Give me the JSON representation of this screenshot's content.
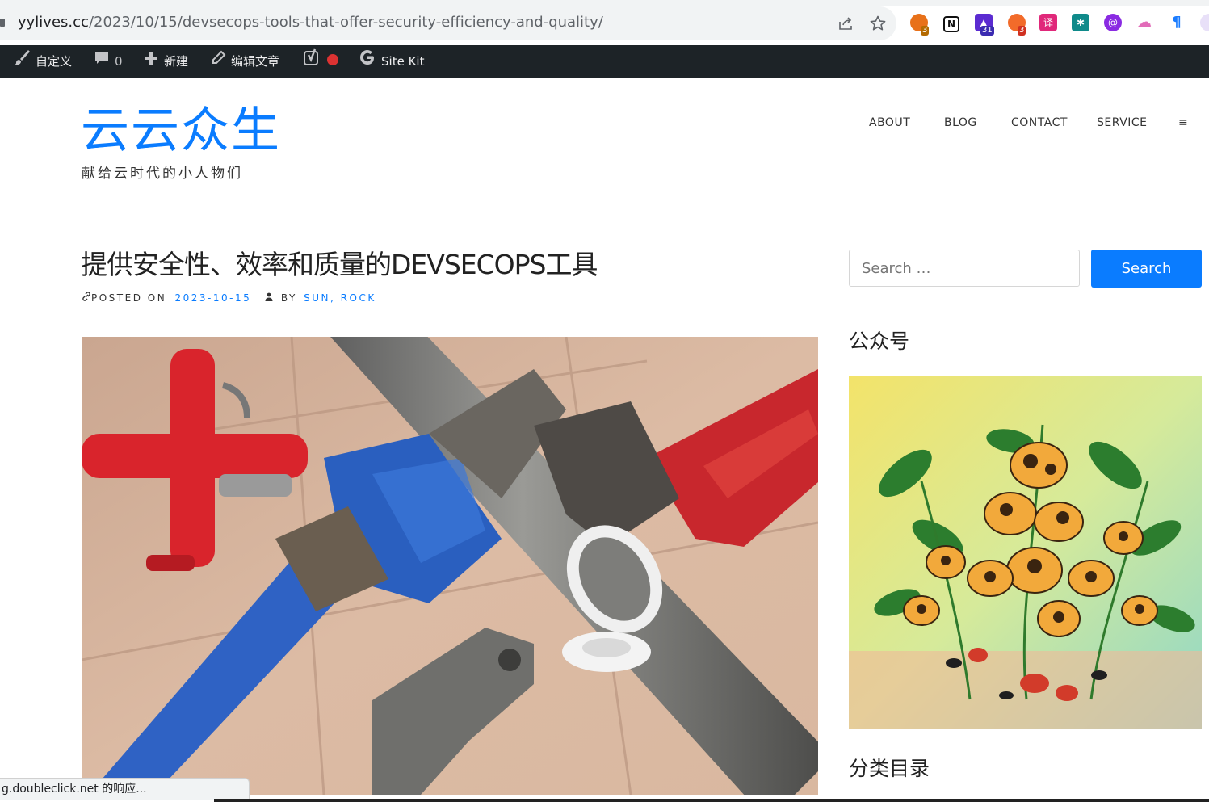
{
  "browser": {
    "url_host": "yylives.cc",
    "url_path": "/2023/10/15/devsecops-tools-that-offer-security-efficiency-and-quality/",
    "icons": [
      "lock-icon",
      "share-icon",
      "bookmark-star-icon"
    ],
    "extensions": [
      {
        "name": "ext-translate-icon",
        "badge": "3",
        "color": "#e8711a"
      },
      {
        "name": "ext-notion-icon",
        "badge": "",
        "color": "#111111"
      },
      {
        "name": "ext-graduation-icon",
        "badge": "31",
        "color": "#5b2bd1"
      },
      {
        "name": "ext-fox-icon",
        "badge": "3",
        "color": "#f26b2a"
      },
      {
        "name": "ext-pink-icon",
        "badge": "",
        "color": "#e0287a"
      },
      {
        "name": "ext-grid-icon",
        "badge": "",
        "color": "#0f8a8a"
      },
      {
        "name": "ext-purple-circle-icon",
        "badge": "",
        "color": "#8a2be2"
      },
      {
        "name": "ext-cloud-icon",
        "badge": "",
        "color": "#e26bb8"
      },
      {
        "name": "ext-blue-flag-icon",
        "badge": "",
        "color": "#1a7cff"
      }
    ]
  },
  "adminbar": {
    "customize": "自定义",
    "comments_count": "0",
    "new": "新建",
    "edit": "编辑文章",
    "sitekit": "Site Kit"
  },
  "site": {
    "title": "云云众生",
    "description": "献给云时代的小人物们",
    "nav": [
      "ABOUT",
      "BLOG",
      "CONTACT",
      "SERVICE",
      "≡"
    ]
  },
  "post": {
    "title": "提供安全性、效率和质量的DEVSECOPS工具",
    "posted_on_label": "POSTED ON",
    "date": "2023-10-15",
    "by_label": "BY",
    "authors": "SUN, ROCK"
  },
  "sidebar": {
    "search_placeholder": "Search …",
    "search_button": "Search",
    "widget_wechat": "公众号",
    "widget_categories": "分类目录"
  },
  "status_text": "g.doubleclick.net 的响应...",
  "colors": {
    "accent": "#0a7cff",
    "adminbar": "#1d2327"
  }
}
